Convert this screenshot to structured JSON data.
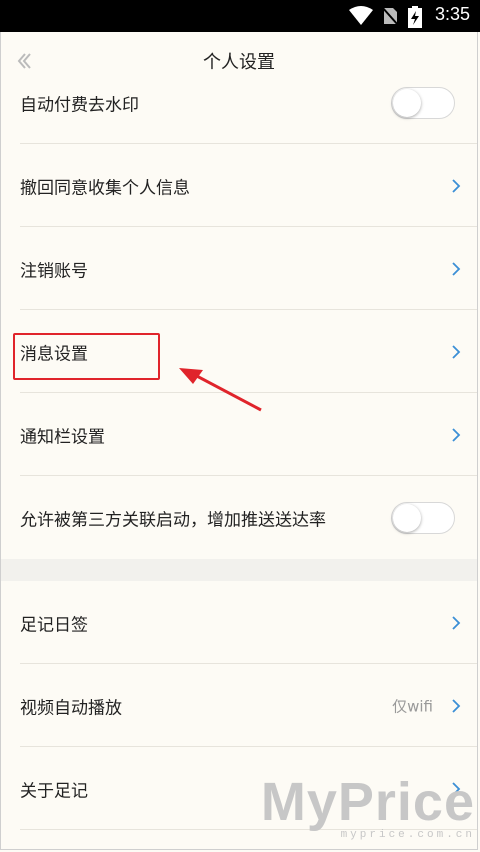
{
  "status_bar": {
    "time": "3:35"
  },
  "header": {
    "title": "个人设置"
  },
  "settings": {
    "auto_pay_watermark": {
      "label": "自动付费去水印",
      "on": false
    },
    "revoke_consent": {
      "label": "撤回同意收集个人信息"
    },
    "delete_account": {
      "label": "注销账号"
    },
    "message_settings": {
      "label": "消息设置"
    },
    "notification_bar": {
      "label": "通知栏设置"
    },
    "allow_third_party": {
      "label": "允许被第三方关联启动，增加推送送达率",
      "on": false
    },
    "footprint_daily": {
      "label": "足记日签"
    },
    "video_autoplay": {
      "label": "视频自动播放",
      "value": "仅wifi"
    },
    "about": {
      "label": "关于足记"
    }
  },
  "watermark": {
    "brand": "MyPrice",
    "site": "myprice.com.cn"
  },
  "colors": {
    "highlight": "#e0242b",
    "accent": "#3b8fd6",
    "background": "#fdfbf5"
  }
}
